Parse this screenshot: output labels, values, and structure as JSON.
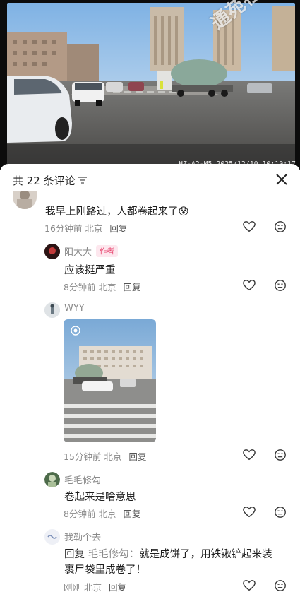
{
  "video": {
    "osd_text": "HZ-A2-M5  2025/12/10 10:10:17",
    "watermark": "通苑社区网"
  },
  "comments_header": {
    "count_label": "共 22 条评论",
    "sort_icon": "sort-icon",
    "close_icon": "close-icon"
  },
  "comments": [
    {
      "name": "",
      "text": "我早上刚路过，人都卷起来了😰",
      "time": "16分钟前",
      "location": "北京",
      "reply_label": "回复"
    },
    {
      "name": "阳大大",
      "badge": "作者",
      "text": "应该挺严重",
      "time": "8分钟前",
      "location": "北京",
      "reply_label": "回复"
    },
    {
      "name": "WYY",
      "text": "",
      "time": "15分钟前",
      "location": "北京",
      "reply_label": "回复",
      "has_image": true
    },
    {
      "name": "毛毛修勾",
      "text": "卷起来是啥意思",
      "time": "8分钟前",
      "location": "北京",
      "reply_label": "回复"
    },
    {
      "name": "我勒个去",
      "reply_prefix": "回复",
      "reply_target": "毛毛修勾：",
      "text_line1": "就是成饼了，用铁锹铲起来装",
      "text_line2": "裹尸袋里成卷了！",
      "time": "刚刚",
      "location": "北京",
      "reply_label": "回复"
    }
  ],
  "colors": {
    "accent_author": "#e8436d",
    "text_primary": "#1f1f1f",
    "text_secondary": "#8a8a8a"
  }
}
